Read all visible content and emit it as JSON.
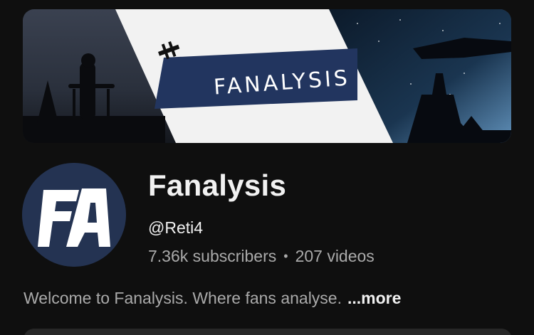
{
  "banner": {
    "title": "FANALYSIS"
  },
  "channel": {
    "name": "Fanalysis",
    "handle": "@Reti4",
    "subscribers": "7.36k subscribers",
    "separator": "•",
    "videos": "207 videos"
  },
  "description": {
    "text": "Welcome to Fanalysis. Where fans analyse.",
    "more_label": "...more"
  },
  "colors": {
    "background": "#0f0f0f",
    "primary_text": "#f1f1f1",
    "secondary_text": "#aaaaaa",
    "banner_blue": "#22355f",
    "avatar_blue": "#243352"
  }
}
